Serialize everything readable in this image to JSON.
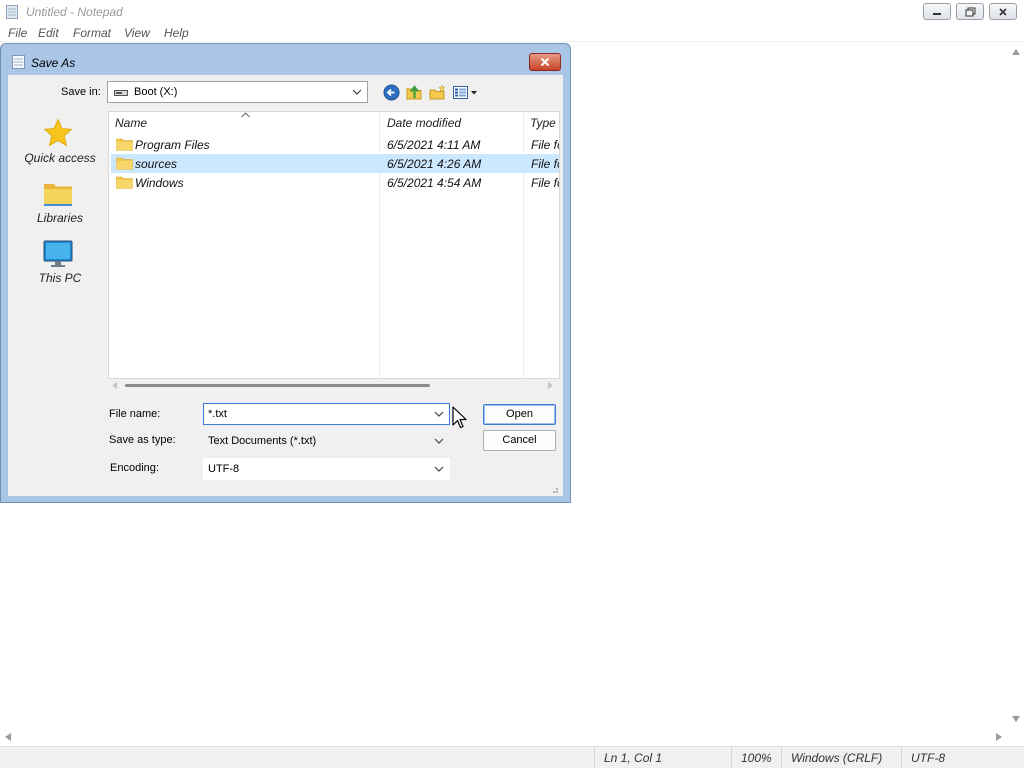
{
  "notepad": {
    "title": "Untitled - Notepad",
    "menu": [
      "File",
      "Edit",
      "Format",
      "View",
      "Help"
    ],
    "status": {
      "position": "Ln 1, Col 1",
      "zoom": "100%",
      "line_endings": "Windows (CRLF)",
      "encoding": "UTF-8"
    }
  },
  "dialog": {
    "title": "Save As",
    "save_in_label": "Save in:",
    "save_in_value": "Boot (X:)",
    "places": [
      {
        "label": "Quick access",
        "icon": "star-icon"
      },
      {
        "label": "Libraries",
        "icon": "libraries-folder-icon"
      },
      {
        "label": "This PC",
        "icon": "monitor-icon"
      }
    ],
    "columns": {
      "name": "Name",
      "date": "Date modified",
      "type": "Type"
    },
    "files": [
      {
        "name": "Program Files",
        "date": "6/5/2021 4:11 AM",
        "type": "File fo"
      },
      {
        "name": "sources",
        "date": "6/5/2021 4:26 AM",
        "type": "File fo"
      },
      {
        "name": "Windows",
        "date": "6/5/2021 4:54 AM",
        "type": "File fo"
      }
    ],
    "selected_row": "sources",
    "file_name_label": "File name:",
    "file_name_value": "*.txt",
    "save_type_label": "Save as type:",
    "save_type_value": "Text Documents (*.txt)",
    "encoding_label": "Encoding:",
    "encoding_value": "UTF-8",
    "open_label": "Open",
    "cancel_label": "Cancel"
  },
  "colors": {
    "selection": "#cce8ff",
    "dialog_frame": "#a9c6e6",
    "close_button": "#c8432a",
    "folder": "#f2c94c"
  }
}
